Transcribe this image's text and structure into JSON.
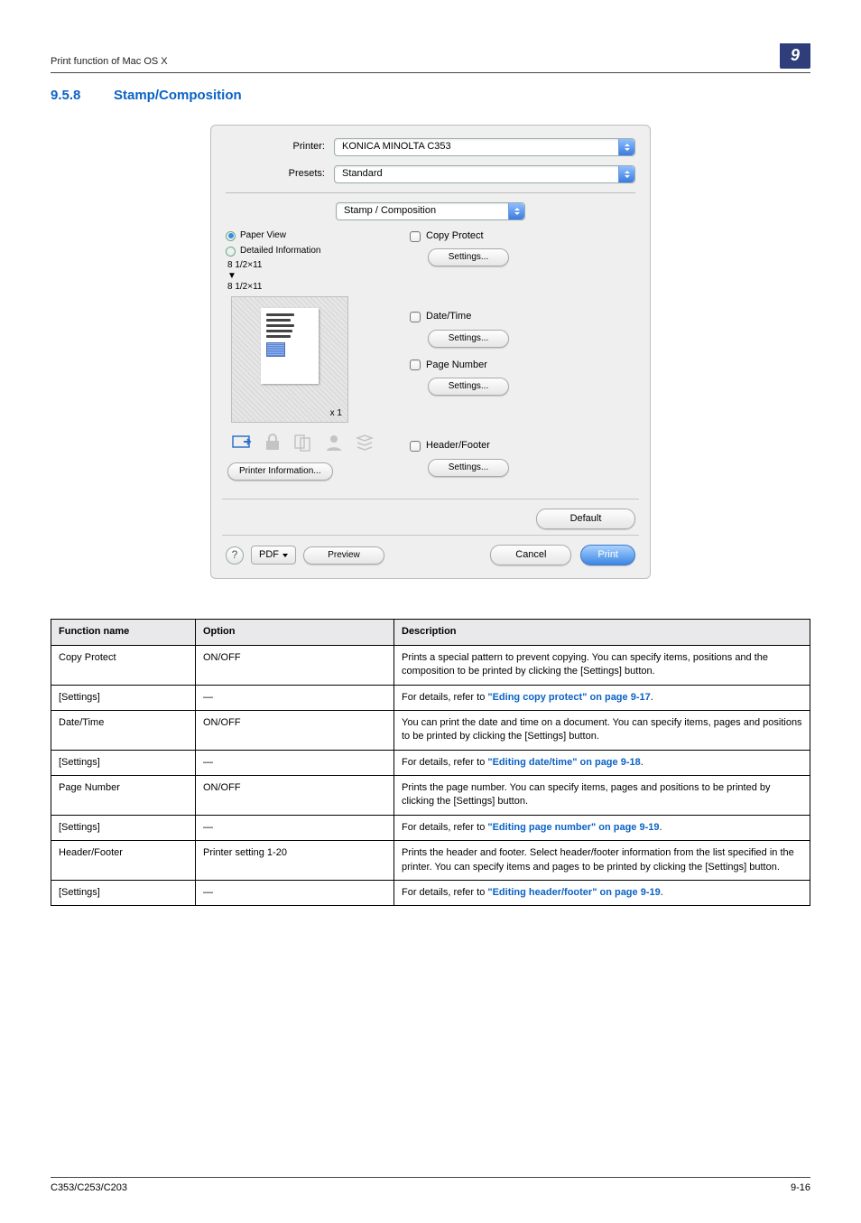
{
  "header": {
    "title": "Print function of Mac OS X",
    "chapter": "9"
  },
  "section": {
    "number": "9.5.8",
    "title": "Stamp/Composition"
  },
  "dialog": {
    "printer_label": "Printer:",
    "printer_value": "KONICA MINOLTA C353",
    "presets_label": "Presets:",
    "presets_value": "Standard",
    "panel_value": "Stamp / Composition",
    "radios": {
      "paper_view": "Paper View",
      "detailed": "Detailed Information"
    },
    "paper_from": "8 1/2×11",
    "paper_to": "8 1/2×11",
    "x1": "x 1",
    "printer_info_btn": "Printer Information...",
    "groups": {
      "copy_protect": "Copy Protect",
      "date_time": "Date/Time",
      "page_number": "Page Number",
      "header_footer": "Header/Footer",
      "settings_btn": "Settings..."
    },
    "default_btn": "Default",
    "pdf_btn": "PDF",
    "preview_btn": "Preview",
    "cancel_btn": "Cancel",
    "print_btn": "Print"
  },
  "table": {
    "head": {
      "c1": "Function name",
      "c2": "Option",
      "c3": "Description"
    },
    "rows": [
      {
        "c1": "Copy Protect",
        "c2": "ON/OFF",
        "c3": "Prints a special pattern to prevent copying. You can specify items, positions and the composition to be printed by clicking the [Settings] button."
      },
      {
        "c1": "[Settings]",
        "c2": "—",
        "c3pre": "For details, refer to ",
        "link": "\"Eding copy protect\" on page 9-17",
        "c3post": "."
      },
      {
        "c1": "Date/Time",
        "c2": "ON/OFF",
        "c3": "You can print the date and time on a document. You can specify items, pages and positions to be printed by clicking the [Settings] button."
      },
      {
        "c1": "[Settings]",
        "c2": "—",
        "c3pre": "For details, refer to ",
        "link": "\"Editing date/time\" on page 9-18",
        "c3post": "."
      },
      {
        "c1": "Page Number",
        "c2": "ON/OFF",
        "c3": "Prints the page number. You can specify items, pages and positions to be printed by clicking the [Settings] button."
      },
      {
        "c1": "[Settings]",
        "c2": "—",
        "c3pre": "For details, refer to ",
        "link": "\"Editing page number\" on page 9-19",
        "c3post": "."
      },
      {
        "c1": "Header/Footer",
        "c2": "Printer setting 1-20",
        "c3": "Prints the header and footer. Select header/footer information from the list specified in the printer. You can specify items and pages to be printed by clicking the [Settings] button."
      },
      {
        "c1": "[Settings]",
        "c2": "—",
        "c3pre": "For details, refer to ",
        "link": "\"Editing header/footer\" on page 9-19",
        "c3post": "."
      }
    ]
  },
  "footer": {
    "model": "C353/C253/C203",
    "page": "9-16"
  }
}
